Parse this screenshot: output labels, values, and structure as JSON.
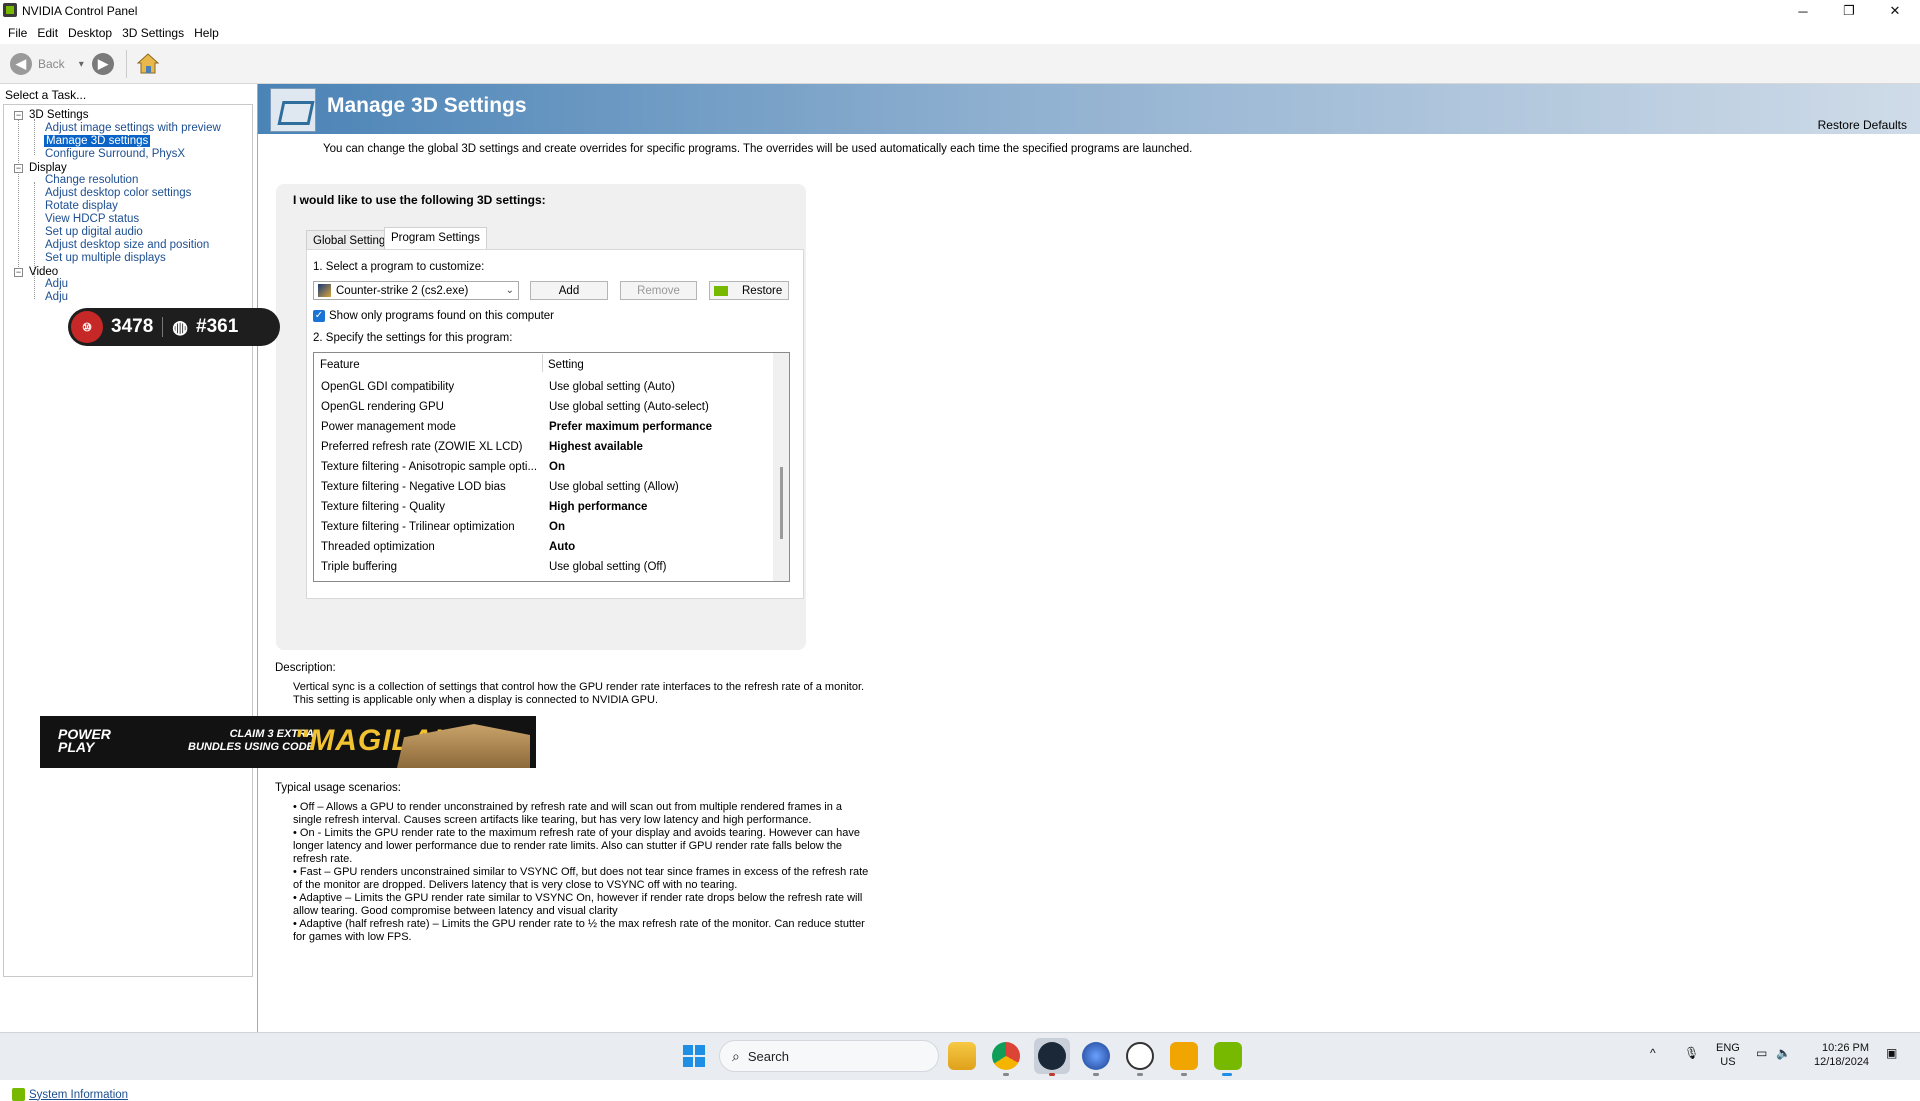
{
  "window": {
    "title": "NVIDIA Control Panel",
    "controls": {
      "minimize": "─",
      "maximize": "❐",
      "close": "✕"
    }
  },
  "menubar": [
    "File",
    "Edit",
    "Desktop",
    "3D Settings",
    "Help"
  ],
  "toolbar": {
    "back_label": "Back",
    "back_caret": "▾"
  },
  "left_pane": {
    "task_label": "Select a Task...",
    "categories": [
      {
        "label": "3D Settings",
        "items": [
          "Adjust image settings with preview",
          "Manage 3D settings",
          "Configure Surround, PhysX"
        ]
      },
      {
        "label": "Display",
        "items": [
          "Change resolution",
          "Adjust desktop color settings",
          "Rotate display",
          "View HDCP status",
          "Set up digital audio",
          "Adjust desktop size and position",
          "Set up multiple displays"
        ]
      },
      {
        "label": "Video",
        "items": [
          "Adju",
          "Adju"
        ]
      }
    ],
    "selected_item": "Manage 3D settings",
    "system_info": "System Information"
  },
  "overlay": {
    "rating": "3478",
    "rank": "#361"
  },
  "ad": {
    "logo": [
      "POWER",
      "PLAY"
    ],
    "claim": [
      "CLAIM 3 EXTRA",
      "BUNDLES USING CODE"
    ],
    "code": "\"MAGILA\""
  },
  "main": {
    "title": "Manage 3D Settings",
    "restore_defaults": "Restore Defaults",
    "intro": "You can change the global 3D settings and create overrides for specific programs. The overrides will be used automatically each time the specified programs are launched.",
    "settings_heading": "I would like to use the following 3D settings:",
    "tabs": [
      "Global Settings",
      "Program Settings"
    ],
    "active_tab": "Program Settings",
    "step1": "1. Select a program to customize:",
    "program": "Counter-strike 2 (cs2.exe)",
    "buttons": {
      "add": "Add",
      "remove": "Remove",
      "restore": "Restore"
    },
    "show_only": "Show only programs found on this computer",
    "show_only_checked": true,
    "step2": "2. Specify the settings for this program:",
    "grid_headers": {
      "feature": "Feature",
      "setting": "Setting"
    },
    "grid_rows": [
      {
        "feature": "OpenGL GDI compatibility",
        "setting": "Use global setting (Auto)",
        "bold": false
      },
      {
        "feature": "OpenGL rendering GPU",
        "setting": "Use global setting (Auto-select)",
        "bold": false
      },
      {
        "feature": "Power management mode",
        "setting": "Prefer maximum performance",
        "bold": true
      },
      {
        "feature": "Preferred refresh rate (ZOWIE XL LCD)",
        "setting": "Highest available",
        "bold": true
      },
      {
        "feature": "Texture filtering - Anisotropic sample opti...",
        "setting": "On",
        "bold": true
      },
      {
        "feature": "Texture filtering - Negative LOD bias",
        "setting": "Use global setting (Allow)",
        "bold": false
      },
      {
        "feature": "Texture filtering - Quality",
        "setting": "High performance",
        "bold": true
      },
      {
        "feature": "Texture filtering - Trilinear optimization",
        "setting": "On",
        "bold": true
      },
      {
        "feature": "Threaded optimization",
        "setting": "Auto",
        "bold": true
      },
      {
        "feature": "Triple buffering",
        "setting": "Use global setting (Off)",
        "bold": false
      }
    ],
    "description_label": "Description:",
    "description": "Vertical sync is a collection of settings that control how the GPU render rate interfaces to the refresh rate of a monitor. Causes screen artifacts like tearing, but has very low latency and high performance. This setting is applicable only when a display is connected to NVIDIA GPU.",
    "description_lines": [
      "Vertical sync is a collection of settings that control how the GPU render rate interfaces to the refresh rate of a monitor.",
      "This setting is applicable only when a display is connected to NVIDIA GPU."
    ],
    "usage_label": "Typical usage scenarios:",
    "usage": [
      "• Off – Allows a GPU to render unconstrained by refresh rate and will scan out from multiple rendered frames in a single refresh interval. Causes screen artifacts like tearing, but has very low latency and high performance.",
      "• On - Limits the GPU render rate to the maximum refresh rate of your display and avoids tearing. However can have longer latency and lower performance due to render rate limits. Also can stutter if GPU render rate falls below the refresh rate.",
      "• Fast – GPU renders unconstrained similar to VSYNC Off, but does not tear since frames in excess of the refresh rate of the monitor are dropped. Delivers latency that is very close to VSYNC off with no tearing.",
      "• Adaptive – Limits the GPU render rate similar to VSYNC On, however if render rate drops below the refresh rate will allow tearing. Good compromise between latency and visual clarity",
      "• Adaptive (half refresh rate) – Limits the GPU render rate to ½ the max refresh rate of the monitor. Can reduce stutter for games with low FPS."
    ]
  },
  "taskbar": {
    "search_placeholder": "Search",
    "language": "ENG",
    "region": "US",
    "time": "10:26 PM",
    "date": "12/18/2024",
    "tray_caret": "^"
  },
  "colors": {
    "accent": "#0a64c8",
    "nvidia_green": "#76b900",
    "link": "#1d4f91"
  }
}
